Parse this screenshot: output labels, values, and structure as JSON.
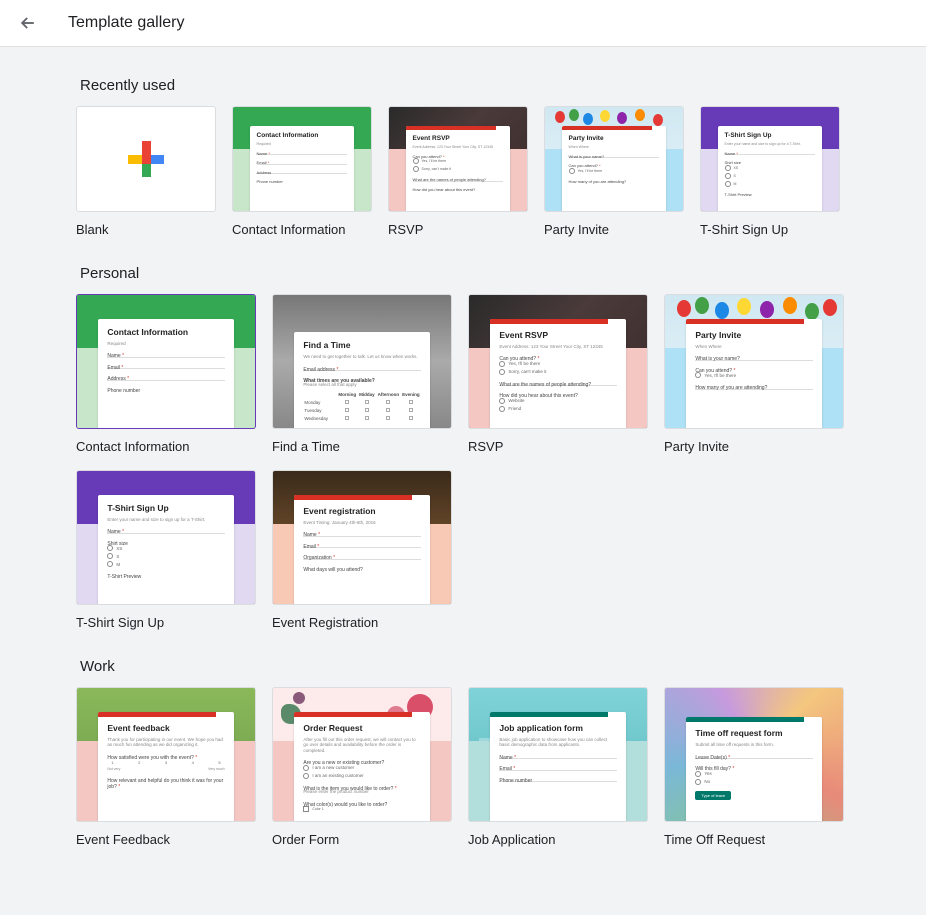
{
  "header": {
    "title": "Template gallery"
  },
  "sections": {
    "recent": {
      "label": "Recently used",
      "items": [
        {
          "label": "Blank"
        },
        {
          "label": "Contact Information"
        },
        {
          "label": "RSVP"
        },
        {
          "label": "Party Invite"
        },
        {
          "label": "T-Shirt Sign Up"
        }
      ]
    },
    "personal": {
      "label": "Personal",
      "items": [
        {
          "label": "Contact Information"
        },
        {
          "label": "Find a Time"
        },
        {
          "label": "RSVP"
        },
        {
          "label": "Party Invite"
        },
        {
          "label": "T-Shirt Sign Up"
        },
        {
          "label": "Event Registration"
        }
      ]
    },
    "work": {
      "label": "Work",
      "items": [
        {
          "label": "Event Feedback"
        },
        {
          "label": "Order Form"
        },
        {
          "label": "Job Application"
        },
        {
          "label": "Time Off Request"
        }
      ]
    }
  },
  "previews": {
    "contact": {
      "title": "Contact Information",
      "fields": [
        "Name",
        "Email",
        "Address",
        "Phone number"
      ]
    },
    "rsvp": {
      "title": "Event RSVP",
      "desc": "Event Address: 123 Your Street Your City, ST 12345",
      "q1": "Can you attend?",
      "opts": [
        "Yes, I'll be there",
        "Sorry, can't make it"
      ],
      "q2": "What are the names of people attending?",
      "q3": "How did you hear about this event?",
      "q3opts": [
        "Website",
        "Friend"
      ]
    },
    "party": {
      "title": "Party Invite",
      "q1": "What is your name?",
      "q2": "Can you attend?",
      "opts": [
        "Yes, I'll be there"
      ],
      "q3": "How many of you are attending?"
    },
    "tshirt": {
      "title": "T-Shirt Sign Up",
      "desc": "Enter your name and size to sign up for a T-Shirt.",
      "q1": "Name",
      "q2": "Shirt size",
      "opts": [
        "XS",
        "S",
        "M"
      ],
      "q3": "T-Shirt Preview"
    },
    "findtime": {
      "title": "Find a Time",
      "desc": "We need to get together to talk. Let us know when works.",
      "q1": "Email address",
      "q2": "What times are you available?",
      "q2sub": "Please select all that apply",
      "cols": [
        "",
        "Morning",
        "Midday",
        "Afternoon",
        "Evening"
      ],
      "rows": [
        "Monday",
        "Tuesday",
        "Wednesday"
      ]
    },
    "eventreg": {
      "title": "Event registration",
      "desc": "Event Timing: January 4th-6th, 2016",
      "fields": [
        "Name",
        "Email",
        "Organization",
        "What days will you attend?"
      ]
    },
    "eventfb": {
      "title": "Event feedback",
      "desc": "Thank you for participating in our event. We hope you had as much fun attending as we did organizing it.",
      "q1": "How satisfied were you with the event?",
      "scale": [
        "1",
        "2",
        "3",
        "4",
        "5"
      ],
      "scaleL": "Not very",
      "scaleR": "Very much",
      "q2": "How relevant and helpful do you think it was for your job?"
    },
    "order": {
      "title": "Order Request",
      "desc": "After you fill out this order request, we will contact you to go over details and availability before the order is completed.",
      "q1": "Are you a new or existing customer?",
      "opts1": [
        "I am a new customer",
        "I am an existing customer"
      ],
      "q2": "What is the item you would like to order?",
      "q2sub": "Please enter the product number",
      "q3": "What color(s) would you like to order?",
      "opts3": [
        "Color 1"
      ]
    },
    "jobapp": {
      "title": "Job application form",
      "desc": "Basic job application to showcase how you can collect basic demographic data from applicants.",
      "fields": [
        "Name",
        "Email",
        "Phone number"
      ]
    },
    "timeoff": {
      "title": "Time off request form",
      "desc": "Submit all time off requests in this form.",
      "q1": "Leave Date(s)",
      "q2": "Will this fill day?",
      "opts": [
        "Yes",
        "No"
      ],
      "q3": "Type of leave"
    }
  }
}
